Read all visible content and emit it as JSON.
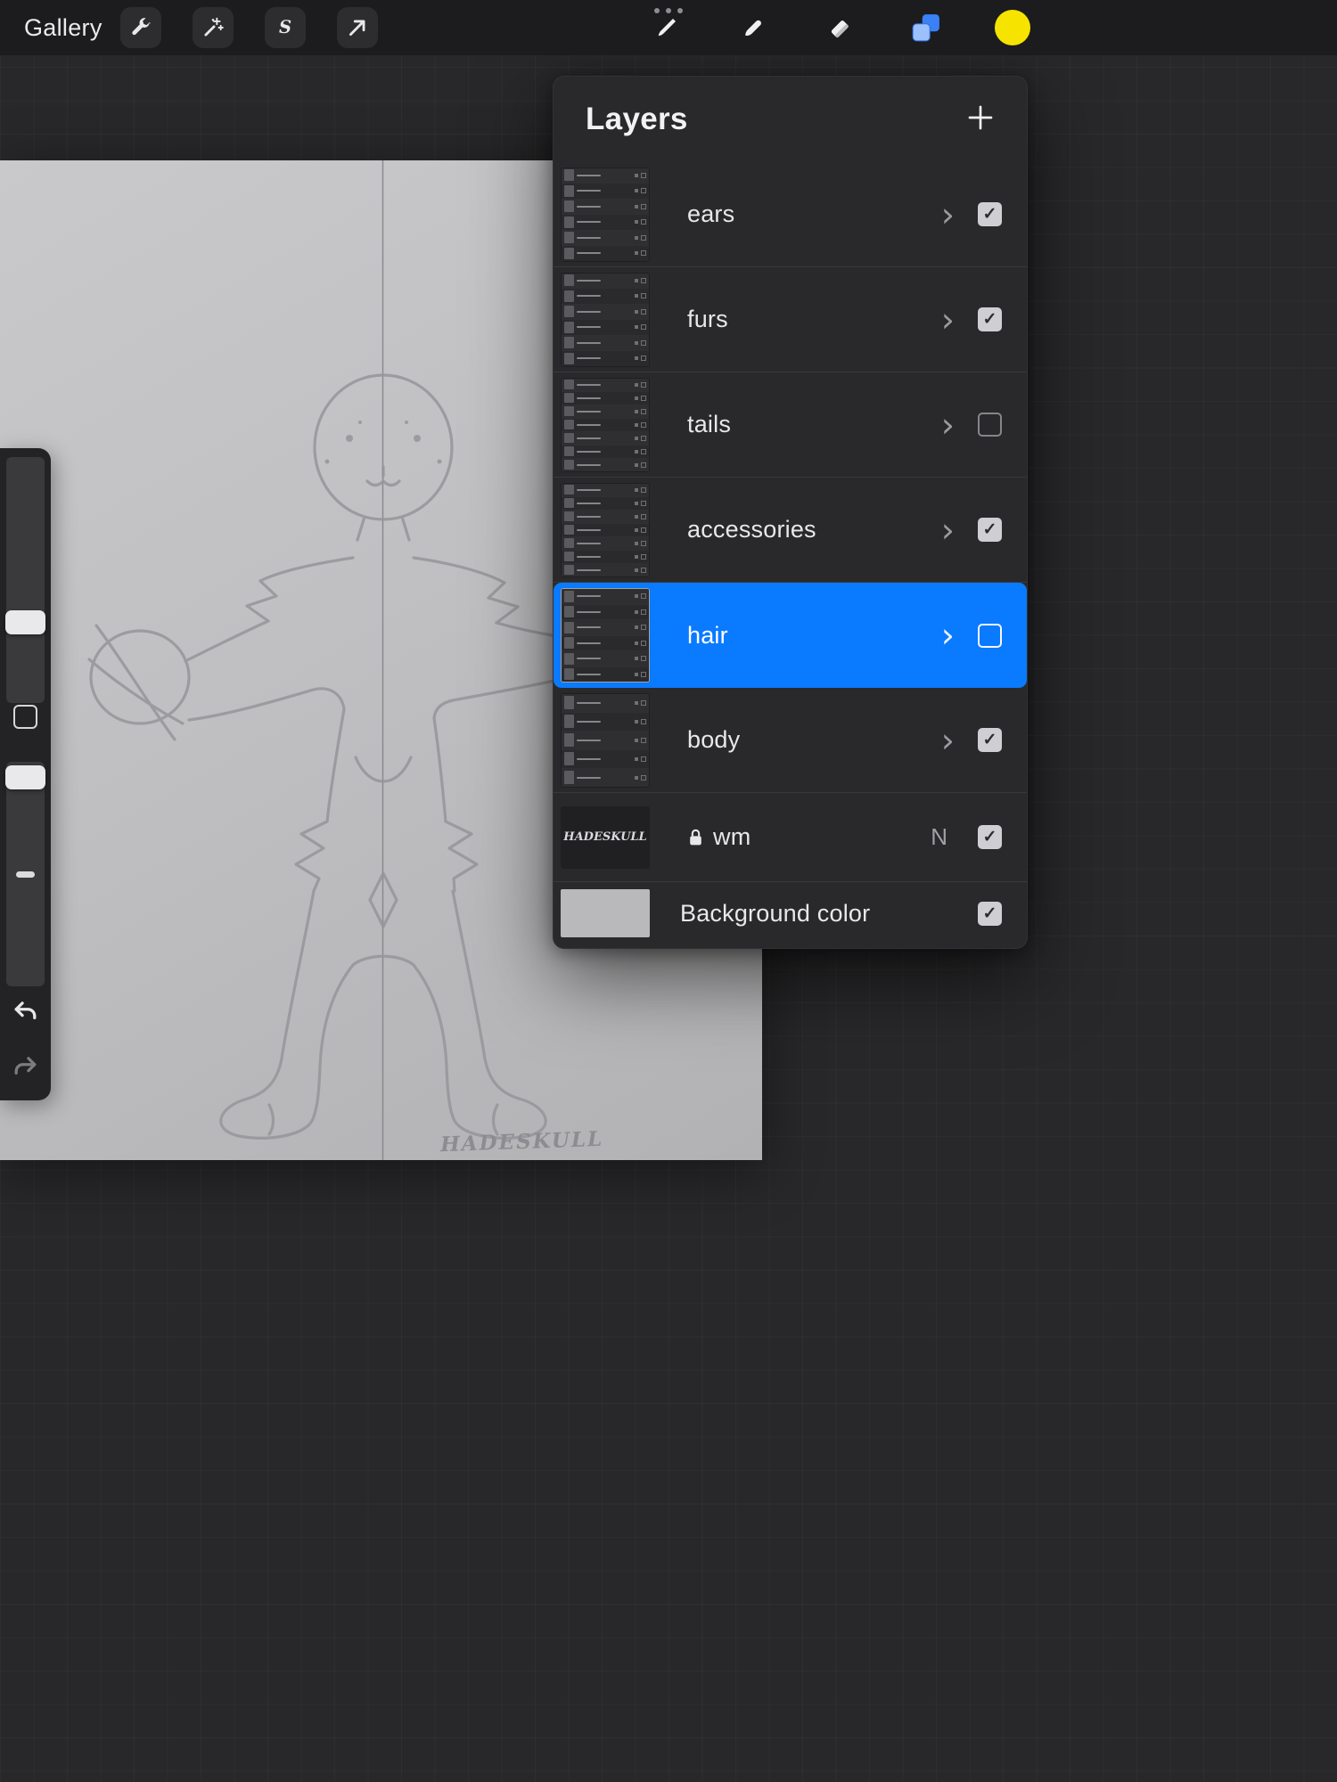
{
  "topbar": {
    "gallery_label": "Gallery"
  },
  "layers_panel": {
    "title": "Layers",
    "rows": [
      {
        "label": "ears",
        "kind": "group",
        "checked": true,
        "selected": false
      },
      {
        "label": "furs",
        "kind": "group",
        "checked": true,
        "selected": false
      },
      {
        "label": "tails",
        "kind": "group",
        "checked": false,
        "selected": false
      },
      {
        "label": "accessories",
        "kind": "group",
        "checked": true,
        "selected": false
      },
      {
        "label": "hair",
        "kind": "group",
        "checked": false,
        "selected": true
      },
      {
        "label": "body",
        "kind": "group",
        "checked": true,
        "selected": false
      },
      {
        "label": "wm",
        "kind": "layer",
        "checked": true,
        "selected": false,
        "locked": true,
        "blend": "N",
        "thumbnail_text": "HADESKULL"
      },
      {
        "label": "Background color",
        "kind": "background",
        "checked": true,
        "selected": false
      }
    ]
  },
  "canvas": {
    "watermark": "HADESKULL"
  },
  "colors": {
    "accent_blue": "#0a7aff",
    "current_color": "#f6e400",
    "panel_bg": "#29292b",
    "topbar_bg": "#1c1c1e",
    "canvas_bg": "#c0c0c2"
  }
}
